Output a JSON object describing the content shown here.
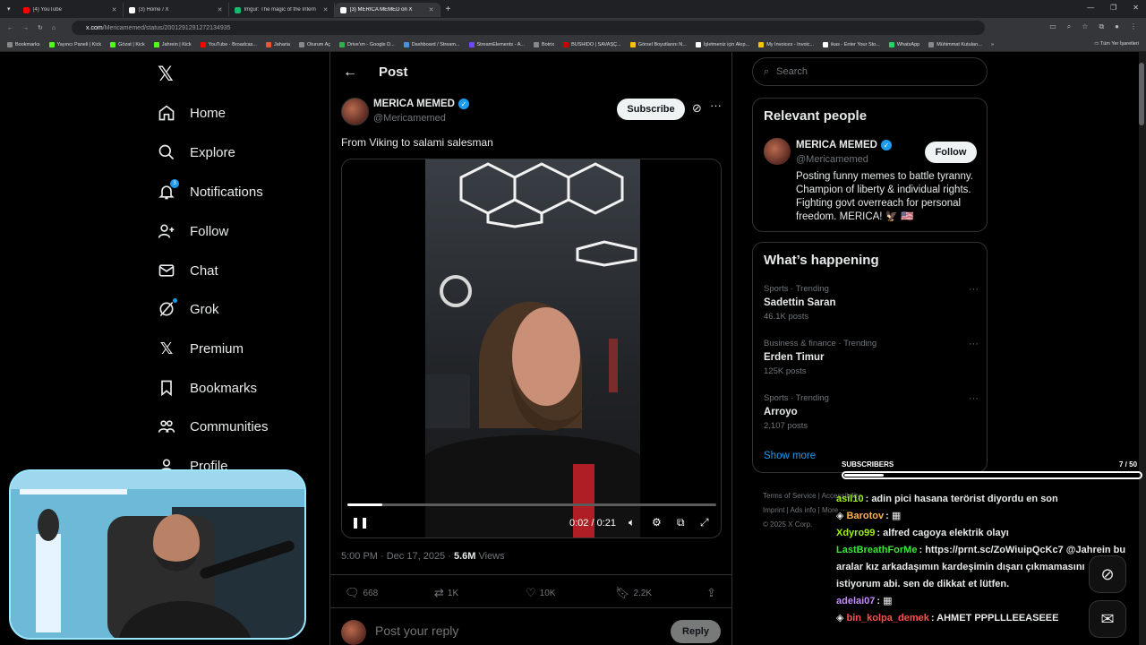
{
  "browser": {
    "tabs": [
      {
        "label": "(4) YouTube",
        "color": "#ff0000",
        "active": false
      },
      {
        "label": "(3) Home / X",
        "color": "#ffffff",
        "active": false
      },
      {
        "label": "Imgur: The magic of the Intern",
        "color": "#1bb76e",
        "active": false
      },
      {
        "label": "(3) MERICA MEMED on X",
        "color": "#ffffff",
        "active": true
      }
    ],
    "url_host": "x.com",
    "url_path": "/Mericamemed/status/2001291291272134935",
    "bookmarks": [
      "Bookmarks",
      "Yayıncı Paneli | Kick",
      "Gözat | Kick",
      "Jahrein | Kick",
      "YouTube - Broadcas...",
      "Jaharia",
      "Oturum Aç",
      "Drive'ım - Google D...",
      "Dashboard / Stream...",
      "StreamElements - A...",
      "Botrix",
      "BUSHIDO | SAVAŞÇ...",
      "Görsel Boyutlarını N...",
      "İşletmeniz için Akıp...",
      "My Invoices - Invoic...",
      "ikas - Enter Your Sto...",
      "WhatsApp",
      "Mühimmat Kutuları..."
    ],
    "all_bookmarks": "Tüm Yer İşaretleri"
  },
  "nav": {
    "items": [
      {
        "label": "Home",
        "icon": "home-icon"
      },
      {
        "label": "Explore",
        "icon": "search-icon"
      },
      {
        "label": "Notifications",
        "icon": "bell-icon",
        "badge": "3"
      },
      {
        "label": "Follow",
        "icon": "follow-icon"
      },
      {
        "label": "Chat",
        "icon": "mail-icon"
      },
      {
        "label": "Grok",
        "icon": "grok-icon"
      },
      {
        "label": "Premium",
        "icon": "x-icon"
      },
      {
        "label": "Bookmarks",
        "icon": "bookmark-icon"
      },
      {
        "label": "Communities",
        "icon": "communities-icon"
      },
      {
        "label": "Profile",
        "icon": "profile-icon"
      }
    ]
  },
  "post": {
    "header": "Post",
    "author_name": "MERICA MEMED",
    "author_handle": "@Mericamemed",
    "subscribe_label": "Subscribe",
    "text": "From Viking to salami salesman",
    "video": {
      "current": "0:02",
      "separator": "/",
      "duration": "0:21",
      "progress": 0.095
    },
    "timestamp": "5:00 PM · Dec 17, 2025 · ",
    "views_count": "5.6M",
    "views_label": "Views",
    "replies": "668",
    "reposts": "1K",
    "likes": "10K",
    "bookmarks": "2.2K",
    "reply_placeholder": "Post your reply",
    "reply_button": "Reply"
  },
  "sidebar": {
    "search_placeholder": "Search",
    "relevant_title": "Relevant people",
    "person_name": "MERICA MEMED",
    "person_handle": "@Mericamemed",
    "follow_label": "Follow",
    "person_bio": "Posting funny memes to battle tyranny. Champion of liberty & individual rights. Fighting govt overreach for personal freedom. MERICA! 🦅 🇺🇸",
    "happening_title": "What’s happening",
    "trends": [
      {
        "category": "Sports · Trending",
        "name": "Sadettin Saran",
        "posts": "46.1K posts"
      },
      {
        "category": "Business & finance · Trending",
        "name": "Erden Timur",
        "posts": "125K posts"
      },
      {
        "category": "Sports · Trending",
        "name": "Arroyo",
        "posts": "2,107 posts"
      }
    ],
    "show_more": "Show more",
    "footer_line1": "Terms of Service",
    "footer_line2": "Imprint",
    "footer_line3": "Accessibility",
    "footer_line4": "Ads info",
    "footer_line5": "More ···",
    "copyright": "© 2025 X Corp."
  },
  "stream": {
    "subs_label": "SUBSCRIBERS",
    "subs_count": "7 / 50",
    "subs_fraction": 0.14,
    "chat": [
      {
        "user": "asil10",
        "color": "#9ef01a",
        "text": ": adin pici hasana terörist diyordu en son"
      },
      {
        "user": "Barotov",
        "color": "#ffb347",
        "text": ":"
      },
      {
        "user": "Xdyro99",
        "color": "#9ef01a",
        "text": ": alfred cagoya elektrik olayı"
      },
      {
        "user": "LastBreathForMe",
        "color": "#39e639",
        "text": ": https://prnt.sc/ZoWiuipQcKc7 @Jahrein bu aralar kız arkadaşımın kardeşimin dışarı çıkmamasını istiyorum abi. sen de dikkat et lütfen."
      },
      {
        "user": "adelai07",
        "color": "#c58cff",
        "text": ":"
      },
      {
        "user": "bin_kolpa_demek",
        "color": "#ff4f4f",
        "text": ": AHMET PPPLLLEEASEEE"
      }
    ]
  }
}
